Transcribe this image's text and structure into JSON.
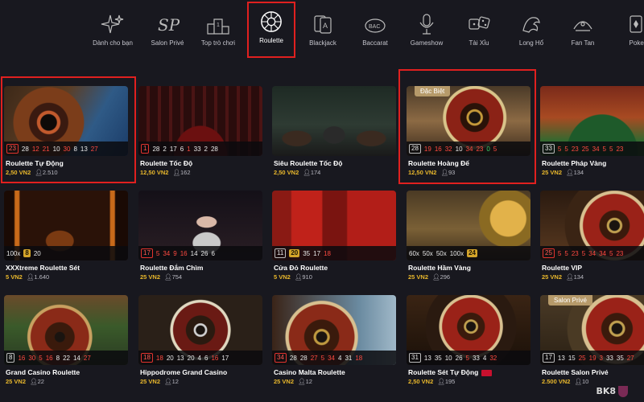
{
  "categories": [
    {
      "label": "Dành cho bạn",
      "icon": "sparkle-icon"
    },
    {
      "label": "Salon Privé",
      "icon": "salon-prive-icon"
    },
    {
      "label": "Top trò chơi",
      "icon": "podium-icon"
    },
    {
      "label": "Roulette",
      "icon": "roulette-wheel-icon"
    },
    {
      "label": "Blackjack",
      "icon": "cards-icon"
    },
    {
      "label": "Baccarat",
      "icon": "baccarat-icon"
    },
    {
      "label": "Gameshow",
      "icon": "microphone-icon"
    },
    {
      "label": "Tài Xỉu",
      "icon": "dice-icon"
    },
    {
      "label": "Long Hổ",
      "icon": "dragon-icon"
    },
    {
      "label": "Fan Tan",
      "icon": "fan-tan-icon"
    },
    {
      "label": "Poker",
      "icon": "poker-icon"
    }
  ],
  "colors": {
    "accent": "#e0201f",
    "price": "#e8b72c",
    "background": "#18181f",
    "red": "#ff4a40",
    "green": "#3ed36a",
    "gold": "#d4a42a"
  },
  "games": [
    {
      "title": "Roulette Tự Động",
      "price": "2,50 VN2",
      "players": "2.510",
      "results": [
        [
          "23",
          "fr"
        ],
        [
          "28",
          "w"
        ],
        [
          "12",
          "r"
        ],
        [
          "21",
          "r"
        ],
        [
          "10",
          "w"
        ],
        [
          "30",
          "r"
        ],
        [
          "8",
          "w"
        ],
        [
          "13",
          "w"
        ],
        [
          "27",
          "r"
        ]
      ]
    },
    {
      "title": "Roulette Tốc Độ",
      "price": "12,50 VN2",
      "players": "162",
      "results": [
        [
          "1",
          "fr"
        ],
        [
          "28",
          "w"
        ],
        [
          "2",
          "w"
        ],
        [
          "17",
          "w"
        ],
        [
          "6",
          "w"
        ],
        [
          "1",
          "r"
        ],
        [
          "33",
          "w"
        ],
        [
          "2",
          "w"
        ],
        [
          "28",
          "w"
        ]
      ]
    },
    {
      "title": "Siêu Roulette Tốc Độ",
      "price": "2,50 VN2",
      "players": "174",
      "results": []
    },
    {
      "title": "Roulette Hoàng Đế",
      "price": "12,50 VN2",
      "players": "93",
      "badge": "Đặc Biệt",
      "results": [
        [
          "28",
          "fw"
        ],
        [
          "19",
          "r"
        ],
        [
          "16",
          "r"
        ],
        [
          "32",
          "r"
        ],
        [
          "10",
          "w"
        ],
        [
          "34",
          "r"
        ],
        [
          "23",
          "r"
        ],
        [
          "0",
          "g"
        ],
        [
          "5",
          "r"
        ]
      ]
    },
    {
      "title": "Roulette Pháp Vàng",
      "price": "25 VN2",
      "players": "134",
      "results": [
        [
          "33",
          "fw"
        ],
        [
          "5",
          "r"
        ],
        [
          "5",
          "r"
        ],
        [
          "23",
          "r"
        ],
        [
          "25",
          "r"
        ],
        [
          "34",
          "r"
        ],
        [
          "5",
          "r"
        ],
        [
          "5",
          "r"
        ],
        [
          "23",
          "r"
        ]
      ]
    },
    {
      "title": "XXXtreme Roulette Sét",
      "price": "5 VN2",
      "players": "1.640",
      "results": [
        [
          "100x",
          "w"
        ],
        [
          "8",
          "y"
        ],
        [
          "20",
          "w"
        ]
      ]
    },
    {
      "title": "Roulette Đắm Chìm",
      "price": "25 VN2",
      "players": "754",
      "results": [
        [
          "17",
          "fr"
        ],
        [
          "5",
          "r"
        ],
        [
          "34",
          "r"
        ],
        [
          "9",
          "r"
        ],
        [
          "16",
          "r"
        ],
        [
          "14",
          "w"
        ],
        [
          "26",
          "w"
        ],
        [
          "6",
          "w"
        ]
      ]
    },
    {
      "title": "Cửa Đỏ Roulette",
      "price": "5 VN2",
      "players": "910",
      "results": [
        [
          "11",
          "fw"
        ],
        [
          "20",
          "y"
        ],
        [
          "35",
          "w"
        ],
        [
          "17",
          "w"
        ],
        [
          "18",
          "r"
        ]
      ]
    },
    {
      "title": "Roulette Hầm Vàng",
      "price": "25 VN2",
      "players": "296",
      "results": [
        [
          "60x",
          "w"
        ],
        [
          "50x",
          "w"
        ],
        [
          "50x",
          "w"
        ],
        [
          "100x",
          "w"
        ],
        [
          "24",
          "y"
        ]
      ]
    },
    {
      "title": "Roulette VIP",
      "price": "25 VN2",
      "players": "134",
      "results": [
        [
          "25",
          "fr"
        ],
        [
          "5",
          "r"
        ],
        [
          "5",
          "r"
        ],
        [
          "23",
          "r"
        ],
        [
          "5",
          "r"
        ],
        [
          "34",
          "r"
        ],
        [
          "34",
          "r"
        ],
        [
          "5",
          "r"
        ],
        [
          "23",
          "r"
        ]
      ]
    },
    {
      "title": "Grand Casino Roulette",
      "price": "25 VN2",
      "players": "22",
      "results": [
        [
          "8",
          "fw"
        ],
        [
          "16",
          "r"
        ],
        [
          "30",
          "r"
        ],
        [
          "5",
          "r"
        ],
        [
          "16",
          "r"
        ],
        [
          "8",
          "w"
        ],
        [
          "22",
          "w"
        ],
        [
          "14",
          "w"
        ],
        [
          "27",
          "r"
        ]
      ]
    },
    {
      "title": "Hippodrome Grand Casino",
      "price": "25 VN2",
      "players": "12",
      "results": [
        [
          "18",
          "fr"
        ],
        [
          "18",
          "r"
        ],
        [
          "20",
          "w"
        ],
        [
          "13",
          "w"
        ],
        [
          "20",
          "w"
        ],
        [
          "4",
          "w"
        ],
        [
          "6",
          "w"
        ],
        [
          "16",
          "r"
        ],
        [
          "17",
          "w"
        ]
      ]
    },
    {
      "title": "Casino Malta Roulette",
      "price": "25 VN2",
      "players": "12",
      "results": [
        [
          "34",
          "fr"
        ],
        [
          "28",
          "w"
        ],
        [
          "28",
          "w"
        ],
        [
          "27",
          "r"
        ],
        [
          "5",
          "r"
        ],
        [
          "34",
          "r"
        ],
        [
          "4",
          "w"
        ],
        [
          "31",
          "w"
        ],
        [
          "18",
          "r"
        ]
      ]
    },
    {
      "title": "Roulette Sét Tự Động",
      "price": "2,50 VN2",
      "players": "195",
      "flag": true,
      "results": [
        [
          "31",
          "fw"
        ],
        [
          "13",
          "w"
        ],
        [
          "35",
          "w"
        ],
        [
          "10",
          "w"
        ],
        [
          "26",
          "w"
        ],
        [
          "5",
          "r"
        ],
        [
          "33",
          "w"
        ],
        [
          "4",
          "w"
        ],
        [
          "32",
          "r"
        ]
      ]
    },
    {
      "title": "Roulette Salon Privé",
      "price": "2.500 VN2",
      "players": "10",
      "badge": "Salon Privé",
      "results": [
        [
          "17",
          "fw"
        ],
        [
          "13",
          "w"
        ],
        [
          "15",
          "w"
        ],
        [
          "25",
          "r"
        ],
        [
          "19",
          "r"
        ],
        [
          "3",
          "r"
        ],
        [
          "33",
          "w"
        ],
        [
          "35",
          "w"
        ],
        [
          "27",
          "r"
        ]
      ]
    }
  ],
  "brand": "BK8"
}
